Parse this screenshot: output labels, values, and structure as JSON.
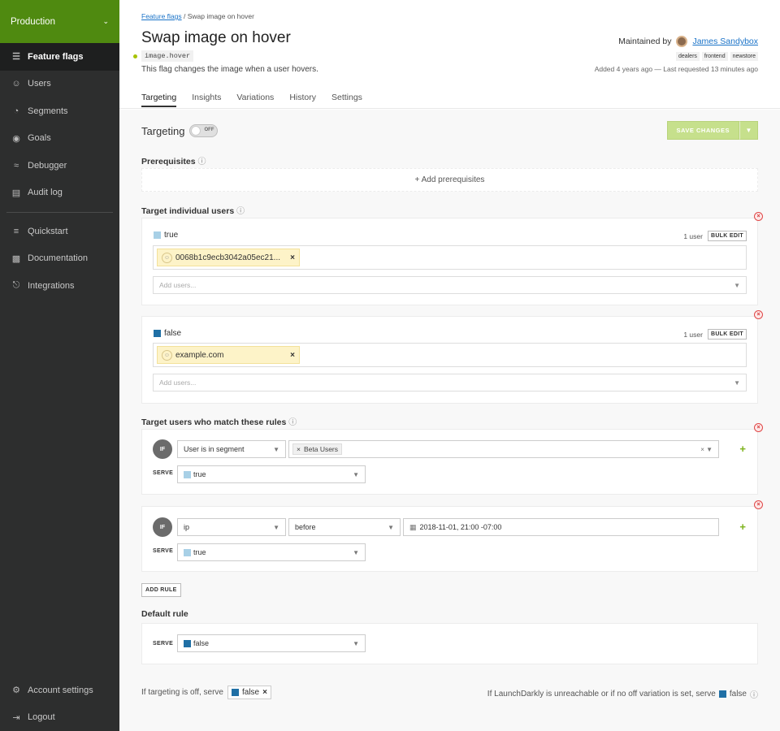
{
  "sidebar": {
    "environment": "Production",
    "items": [
      {
        "label": "Feature flags",
        "icon": "sliders-icon"
      },
      {
        "label": "Users",
        "icon": "users-icon"
      },
      {
        "label": "Segments",
        "icon": "pie-icon"
      },
      {
        "label": "Goals",
        "icon": "target-icon"
      },
      {
        "label": "Debugger",
        "icon": "debugger-icon"
      },
      {
        "label": "Audit log",
        "icon": "audit-icon"
      }
    ],
    "secondary": [
      {
        "label": "Quickstart",
        "icon": "quickstart-icon"
      },
      {
        "label": "Documentation",
        "icon": "docs-icon"
      },
      {
        "label": "Integrations",
        "icon": "plug-icon"
      }
    ],
    "bottom": [
      {
        "label": "Account settings",
        "icon": "gear-icon"
      },
      {
        "label": "Logout",
        "icon": "logout-icon"
      }
    ]
  },
  "header": {
    "breadcrumb_link": "Feature flags",
    "breadcrumb_current": "Swap image on hover",
    "title": "Swap image on hover",
    "flag_key": "image.hover",
    "description": "This flag changes the image when a user hovers.",
    "maintained_label": "Maintained by",
    "maintainer": "James Sandybox",
    "tags": [
      "dealers",
      "frontend",
      "newstore"
    ],
    "added": "Added 4 years ago — Last requested 13 minutes ago",
    "tabs": [
      "Targeting",
      "Insights",
      "Variations",
      "History",
      "Settings"
    ]
  },
  "targeting": {
    "label": "Targeting",
    "toggle_text": "OFF",
    "save_label": "SAVE CHANGES",
    "prerequisites_label": "Prerequisites",
    "add_prereq": "+ Add prerequisites",
    "individual_label": "Target individual users",
    "individual": [
      {
        "variation": "true",
        "count": "1 user",
        "bulk": "BULK EDIT",
        "user": "0068b1c9ecb3042a05ec21...",
        "placeholder": "Add users..."
      },
      {
        "variation": "false",
        "count": "1 user",
        "bulk": "BULK EDIT",
        "user": "example.com",
        "placeholder": "Add users..."
      }
    ],
    "rules_label": "Target users who match these rules",
    "rules": [
      {
        "if": "IF",
        "attribute": "User is in segment",
        "value_chip": "Beta Users",
        "serve_label": "SERVE",
        "serve": "true"
      },
      {
        "if": "IF",
        "attribute": "ip",
        "operator": "before",
        "value": "2018-11-01, 21:00 -07:00",
        "serve_label": "SERVE",
        "serve": "true"
      }
    ],
    "add_rule": "ADD RULE",
    "default_label": "Default rule",
    "default_serve_label": "SERVE",
    "default_serve": "false",
    "off_text": "If targeting is off, serve",
    "off_value": "false",
    "unreachable_text": "If LaunchDarkly is unreachable or if no off variation is set, serve",
    "unreachable_value": "false"
  },
  "colors": {
    "env": "#4f8a10",
    "sidebar": "#2d2e2e",
    "true_swatch": "#a8d0e6",
    "false_swatch": "#1f6fa5"
  }
}
